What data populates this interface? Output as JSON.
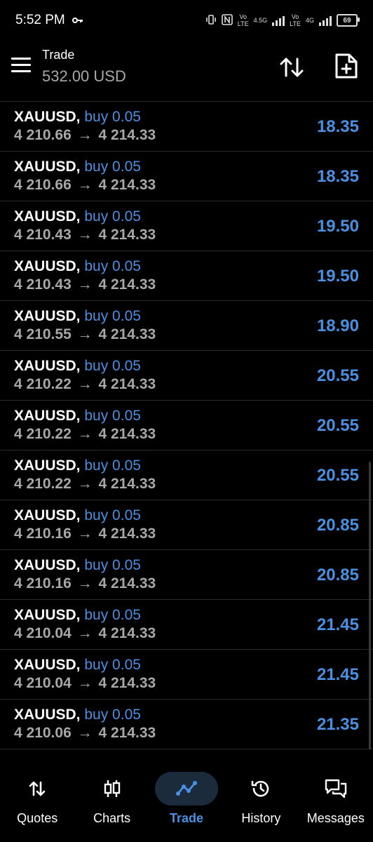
{
  "status_bar": {
    "time": "5:52 PM",
    "network_a": "4.5G",
    "network_b": "4G",
    "volte_top": "Vo",
    "volte_bottom": "LTE",
    "battery": "69"
  },
  "header": {
    "title": "Trade",
    "balance": "532.00 USD"
  },
  "trades": [
    {
      "symbol": "XAUUSD,",
      "side": "buy 0.05",
      "open": "4 210.66",
      "arrow": "→",
      "current": "4 214.33",
      "profit": "18.35"
    },
    {
      "symbol": "XAUUSD,",
      "side": "buy 0.05",
      "open": "4 210.66",
      "arrow": "→",
      "current": "4 214.33",
      "profit": "18.35"
    },
    {
      "symbol": "XAUUSD,",
      "side": "buy 0.05",
      "open": "4 210.43",
      "arrow": "→",
      "current": "4 214.33",
      "profit": "19.50"
    },
    {
      "symbol": "XAUUSD,",
      "side": "buy 0.05",
      "open": "4 210.43",
      "arrow": "→",
      "current": "4 214.33",
      "profit": "19.50"
    },
    {
      "symbol": "XAUUSD,",
      "side": "buy 0.05",
      "open": "4 210.55",
      "arrow": "→",
      "current": "4 214.33",
      "profit": "18.90"
    },
    {
      "symbol": "XAUUSD,",
      "side": "buy 0.05",
      "open": "4 210.22",
      "arrow": "→",
      "current": "4 214.33",
      "profit": "20.55"
    },
    {
      "symbol": "XAUUSD,",
      "side": "buy 0.05",
      "open": "4 210.22",
      "arrow": "→",
      "current": "4 214.33",
      "profit": "20.55"
    },
    {
      "symbol": "XAUUSD,",
      "side": "buy 0.05",
      "open": "4 210.22",
      "arrow": "→",
      "current": "4 214.33",
      "profit": "20.55"
    },
    {
      "symbol": "XAUUSD,",
      "side": "buy 0.05",
      "open": "4 210.16",
      "arrow": "→",
      "current": "4 214.33",
      "profit": "20.85"
    },
    {
      "symbol": "XAUUSD,",
      "side": "buy 0.05",
      "open": "4 210.16",
      "arrow": "→",
      "current": "4 214.33",
      "profit": "20.85"
    },
    {
      "symbol": "XAUUSD,",
      "side": "buy 0.05",
      "open": "4 210.04",
      "arrow": "→",
      "current": "4 214.33",
      "profit": "21.45"
    },
    {
      "symbol": "XAUUSD,",
      "side": "buy 0.05",
      "open": "4 210.04",
      "arrow": "→",
      "current": "4 214.33",
      "profit": "21.45"
    },
    {
      "symbol": "XAUUSD,",
      "side": "buy 0.05",
      "open": "4 210.06",
      "arrow": "→",
      "current": "4 214.33",
      "profit": "21.35"
    }
  ],
  "bottom_nav": [
    {
      "label": "Quotes",
      "icon": "quotes-icon",
      "active": false
    },
    {
      "label": "Charts",
      "icon": "charts-icon",
      "active": false
    },
    {
      "label": "Trade",
      "icon": "trade-icon",
      "active": true
    },
    {
      "label": "History",
      "icon": "history-icon",
      "active": false
    },
    {
      "label": "Messages",
      "icon": "messages-icon",
      "active": false
    }
  ],
  "colors": {
    "accent": "#4a90e2",
    "muted": "#a8a8a8",
    "background": "#000000"
  }
}
